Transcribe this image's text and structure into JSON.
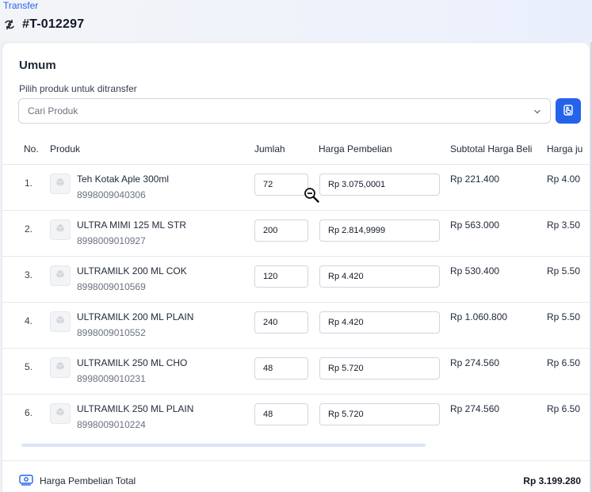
{
  "breadcrumb": "Transfer",
  "header": {
    "title": "#T-012297"
  },
  "section": {
    "title": "Umum",
    "select_label": "Pilih produk untuk ditransfer",
    "select_placeholder": "Cari Produk"
  },
  "table": {
    "columns": [
      "No.",
      "Produk",
      "Jumlah",
      "Harga Pembelian",
      "Subtotal Harga Beli",
      "Harga ju"
    ],
    "rows": [
      {
        "no": "1.",
        "name": "Teh Kotak Aple 300ml",
        "sku": "8998009040306",
        "qty": "72",
        "price": "Rp 3.075,0001",
        "subtotal": "Rp 221.400",
        "sell": "Rp 4.00"
      },
      {
        "no": "2.",
        "name": "ULTRA MIMI 125 ML STR",
        "sku": "8998009010927",
        "qty": "200",
        "price": "Rp 2.814,9999",
        "subtotal": "Rp 563.000",
        "sell": "Rp 3.50"
      },
      {
        "no": "3.",
        "name": "ULTRAMILK 200 ML COK",
        "sku": "8998009010569",
        "qty": "120",
        "price": "Rp 4.420",
        "subtotal": "Rp 530.400",
        "sell": "Rp 5.50"
      },
      {
        "no": "4.",
        "name": "ULTRAMILK 200 ML PLAIN",
        "sku": "8998009010552",
        "qty": "240",
        "price": "Rp 4.420",
        "subtotal": "Rp 1.060.800",
        "sell": "Rp 5.50"
      },
      {
        "no": "5.",
        "name": "ULTRAMILK 250 ML CHO",
        "sku": "8998009010231",
        "qty": "48",
        "price": "Rp 5.720",
        "subtotal": "Rp 274.560",
        "sell": "Rp 6.50"
      },
      {
        "no": "6.",
        "name": "ULTRAMILK 250 ML PLAIN",
        "sku": "8998009010224",
        "qty": "48",
        "price": "Rp 5.720",
        "subtotal": "Rp 274.560",
        "sell": "Rp 6.50"
      }
    ]
  },
  "footer": {
    "label": "Harga Pembelian Total",
    "total": "Rp 3.199.280"
  },
  "colors": {
    "accent": "#2563eb",
    "border": "#d1d5db",
    "text": "#1f2937"
  },
  "icons": {
    "title": "transfer-arrows-icon",
    "select": "chevron-down-icon",
    "scan": "scan-hand-icon",
    "thumb": "box-icon",
    "footer": "money-icon",
    "cursor": "zoom-out-cursor-icon"
  }
}
